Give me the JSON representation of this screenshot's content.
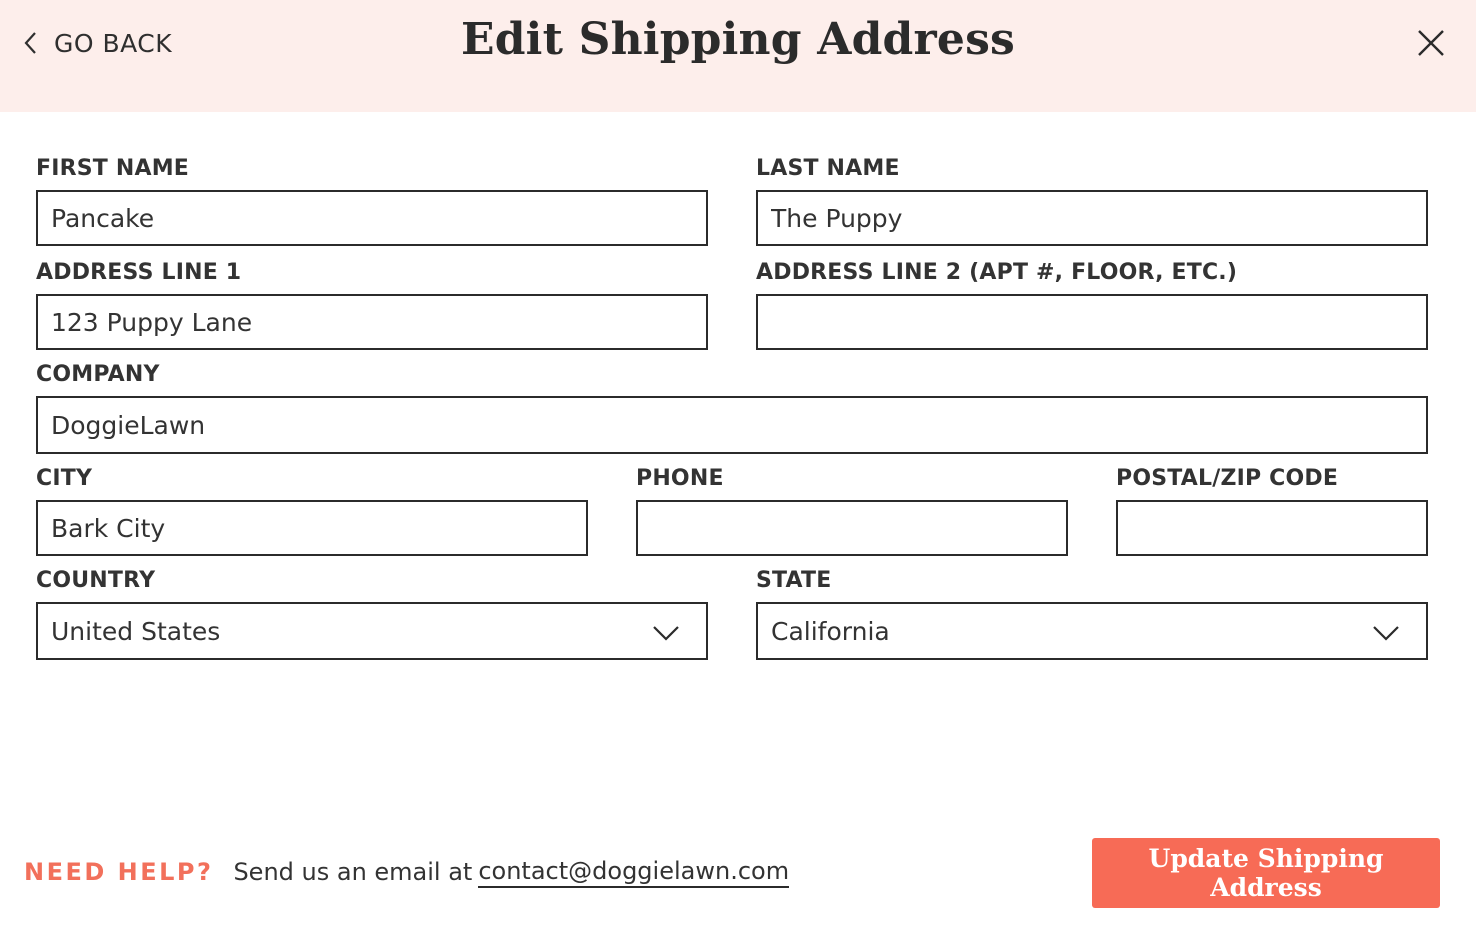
{
  "header": {
    "back_label": "GO BACK",
    "title": "Edit Shipping Address",
    "back_icon": "chevron-left-icon",
    "close_icon": "close-icon"
  },
  "form": {
    "first_name": {
      "label": "FIRST NAME",
      "value": "Pancake"
    },
    "last_name": {
      "label": "LAST NAME",
      "value": "The Puppy"
    },
    "address1": {
      "label": "ADDRESS LINE 1",
      "value": "123 Puppy Lane"
    },
    "address2": {
      "label": "ADDRESS LINE 2 (APT #, FLOOR, ETC.)",
      "value": ""
    },
    "company": {
      "label": "COMPANY",
      "value": "DoggieLawn"
    },
    "city": {
      "label": "CITY",
      "value": "Bark City"
    },
    "phone": {
      "label": "PHONE",
      "value": ""
    },
    "postal": {
      "label": "POSTAL/ZIP CODE",
      "value": ""
    },
    "country": {
      "label": "COUNTRY",
      "value": "United States"
    },
    "state": {
      "label": "STATE",
      "value": "California"
    }
  },
  "footer": {
    "help_label": "NEED HELP?",
    "help_text": "Send us an email at",
    "help_email": "contact@doggielawn.com",
    "submit_label": "Update Shipping Address"
  },
  "colors": {
    "header_bg": "#fdeeeb",
    "accent": "#f76b56",
    "border": "#2b2b2b"
  }
}
